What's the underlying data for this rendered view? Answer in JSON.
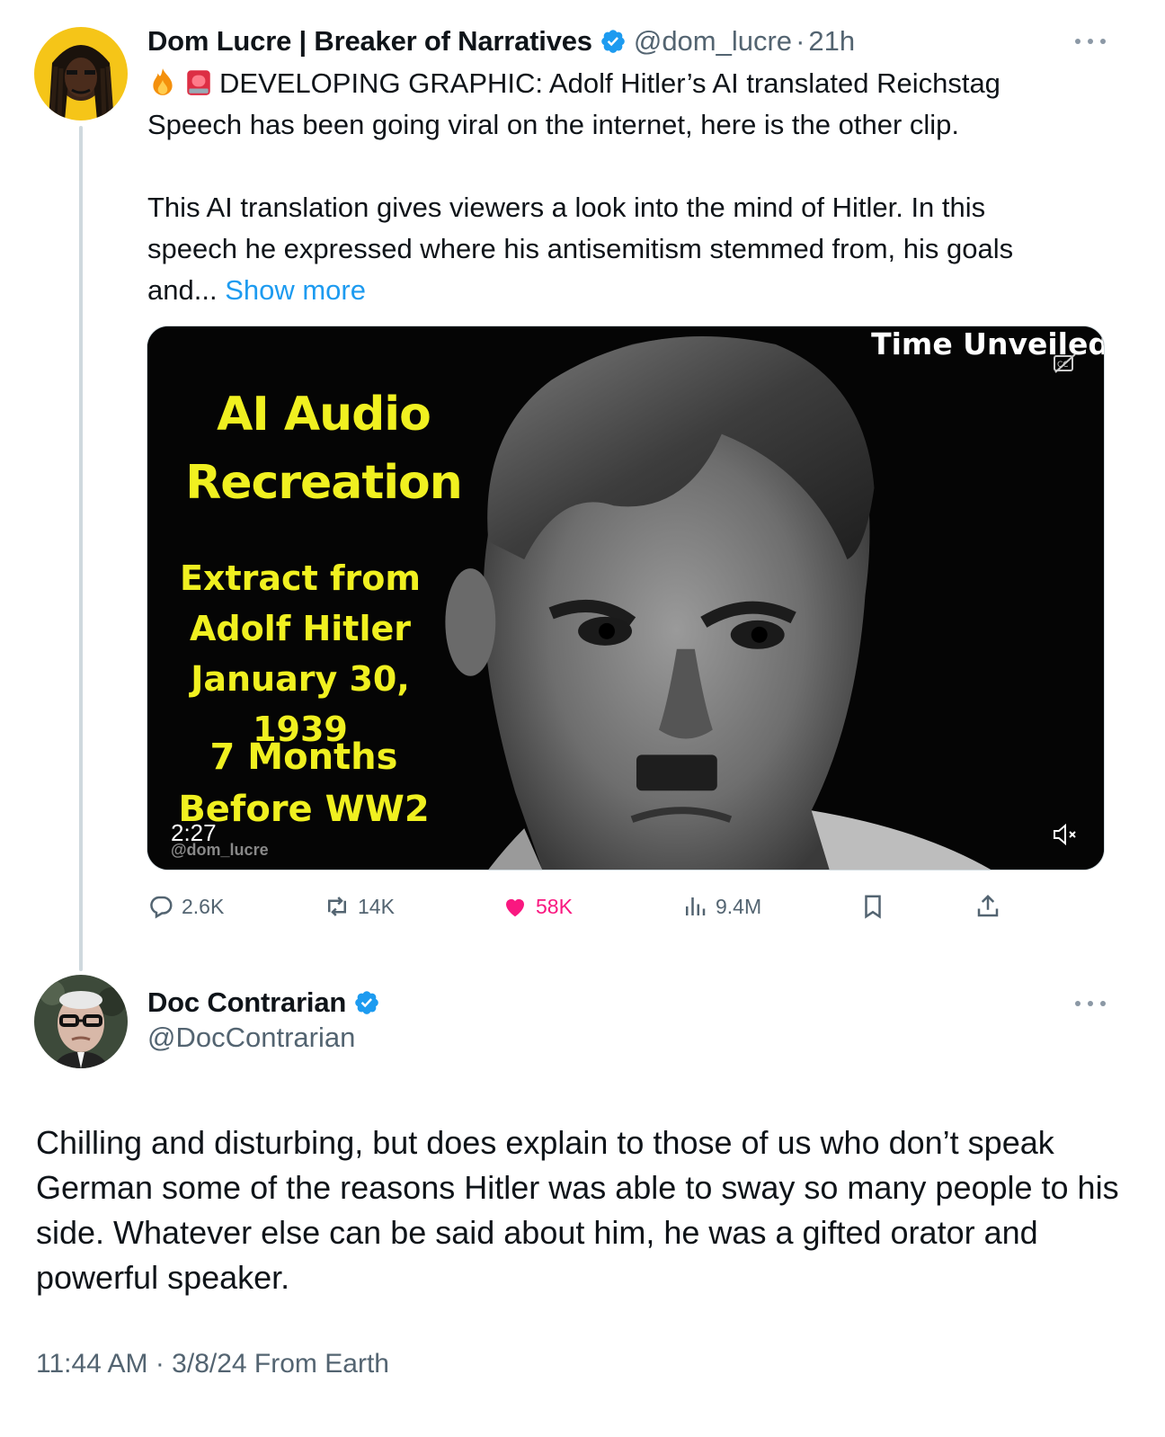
{
  "tweet1": {
    "author_name": "Dom Lucre | Breaker of Narratives",
    "handle": "@dom_lucre",
    "separator": "·",
    "time": "21h",
    "line1": "DEVELOPING GRAPHIC: Adolf Hitler’s AI translated Reichstag",
    "line2": "Speech has been going viral on the internet, here is the other clip.",
    "line3": "This AI translation gives viewers a look into the mind of Hitler. In this",
    "line4": "speech he expressed where his antisemitism stemmed from, his goals",
    "line5_prefix": "and...",
    "show_more": "Show more",
    "media": {
      "channel": "Time Unveiled",
      "title_line1": "AI Audio",
      "title_line2": "Recreation",
      "extract_line1": "Extract from",
      "extract_line2": "Adolf Hitler",
      "extract_line3": "January 30, 1939",
      "months_line1": "7 Months",
      "months_line2": "Before WW2",
      "duration": "2:27",
      "watermark": "@dom_lucre"
    },
    "actions": {
      "replies": "2.6K",
      "reposts": "14K",
      "likes": "58K",
      "views": "9.4M"
    }
  },
  "tweet2": {
    "author_name": "Doc Contrarian",
    "handle": "@DocContrarian",
    "text": "Chilling and disturbing, but does explain to those of us who don’t speak German some of the reasons Hitler was able to sway so many people to his side. Whatever else can be said about him, he was a gifted orator and powerful speaker.",
    "timestamp": "11:44 AM · 3/8/24 From Earth"
  },
  "colors": {
    "verified": "#1d9bf0",
    "like": "#f91880",
    "link": "#1d9bf0",
    "secondary_text": "#536471",
    "media_text": "#f0f020"
  },
  "icons": [
    "fire-emoji",
    "siren-emoji",
    "verified-badge-icon",
    "more-icon",
    "reply-icon",
    "repost-icon",
    "like-heart-icon",
    "views-icon",
    "bookmark-icon",
    "share-icon",
    "cc-icon",
    "mute-icon"
  ]
}
